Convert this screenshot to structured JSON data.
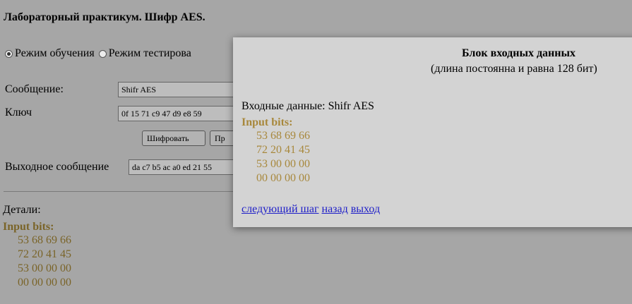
{
  "page": {
    "title": "Лабораторный практикум. Шифр AES."
  },
  "modes": {
    "learning": "Режим обучения",
    "testing": "Режим тестирова",
    "selected": "learning"
  },
  "form": {
    "message_label": "Сообщение:",
    "message_value": "Shifr AES",
    "key_label": "Ключ",
    "key_value": "0f 15 71 c9 47 d9 e8 59",
    "encrypt_label": "Шифровать",
    "second_button_label": "Пр",
    "output_label": "Выходное сообщение",
    "output_value": "da c7 b5 ac a0 ed 21 55"
  },
  "details": {
    "label": "Детали:",
    "bits_title": "Input bits:",
    "rows": [
      "53 68 69 66",
      "72 20 41 45",
      "53 00 00 00",
      "00 00 00 00"
    ]
  },
  "modal": {
    "title": "Блок входных данных",
    "subtitle": "(длина постоянна и равна 128 бит)",
    "input_prefix": "Входные данные:",
    "input_value": "Shifr AES",
    "bits_title": "Input bits:",
    "rows": [
      "53 68 69 66",
      "72 20 41 45",
      "53 00 00 00",
      "00 00 00 00"
    ],
    "links": {
      "next": "следующий шаг",
      "back": "назад",
      "exit": "выход"
    }
  },
  "colors": {
    "background": "#a6a6a6",
    "modal_bg": "#d3d3d3",
    "bits_text": "#a8883c",
    "link": "#2020c8"
  }
}
